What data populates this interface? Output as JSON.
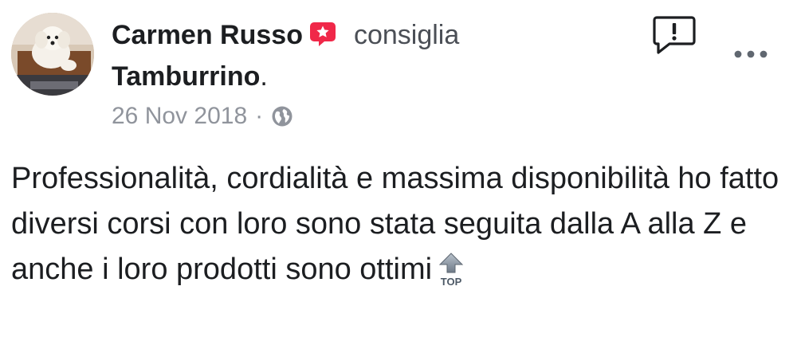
{
  "post": {
    "author": "Carmen Russo",
    "action": "consiglia",
    "page": "Tamburrino",
    "period": ".",
    "date": "26 Nov 2018",
    "separator": "·",
    "body": "Professionalità, cordialità e massima disponibilità ho fatto diversi corsi con loro sono stata seguita dalla A alla Z e anche i loro prodotti sono ottimi",
    "body_emoji": "TOP",
    "icons": {
      "recommend": "recommend-star-icon",
      "privacy": "globe-icon",
      "report": "report-icon",
      "more": "more-options-icon",
      "emoji": "top-arrow-emoji"
    },
    "colors": {
      "recommend": "#f02849",
      "meta": "#90949c",
      "text": "#1c1e21"
    }
  }
}
